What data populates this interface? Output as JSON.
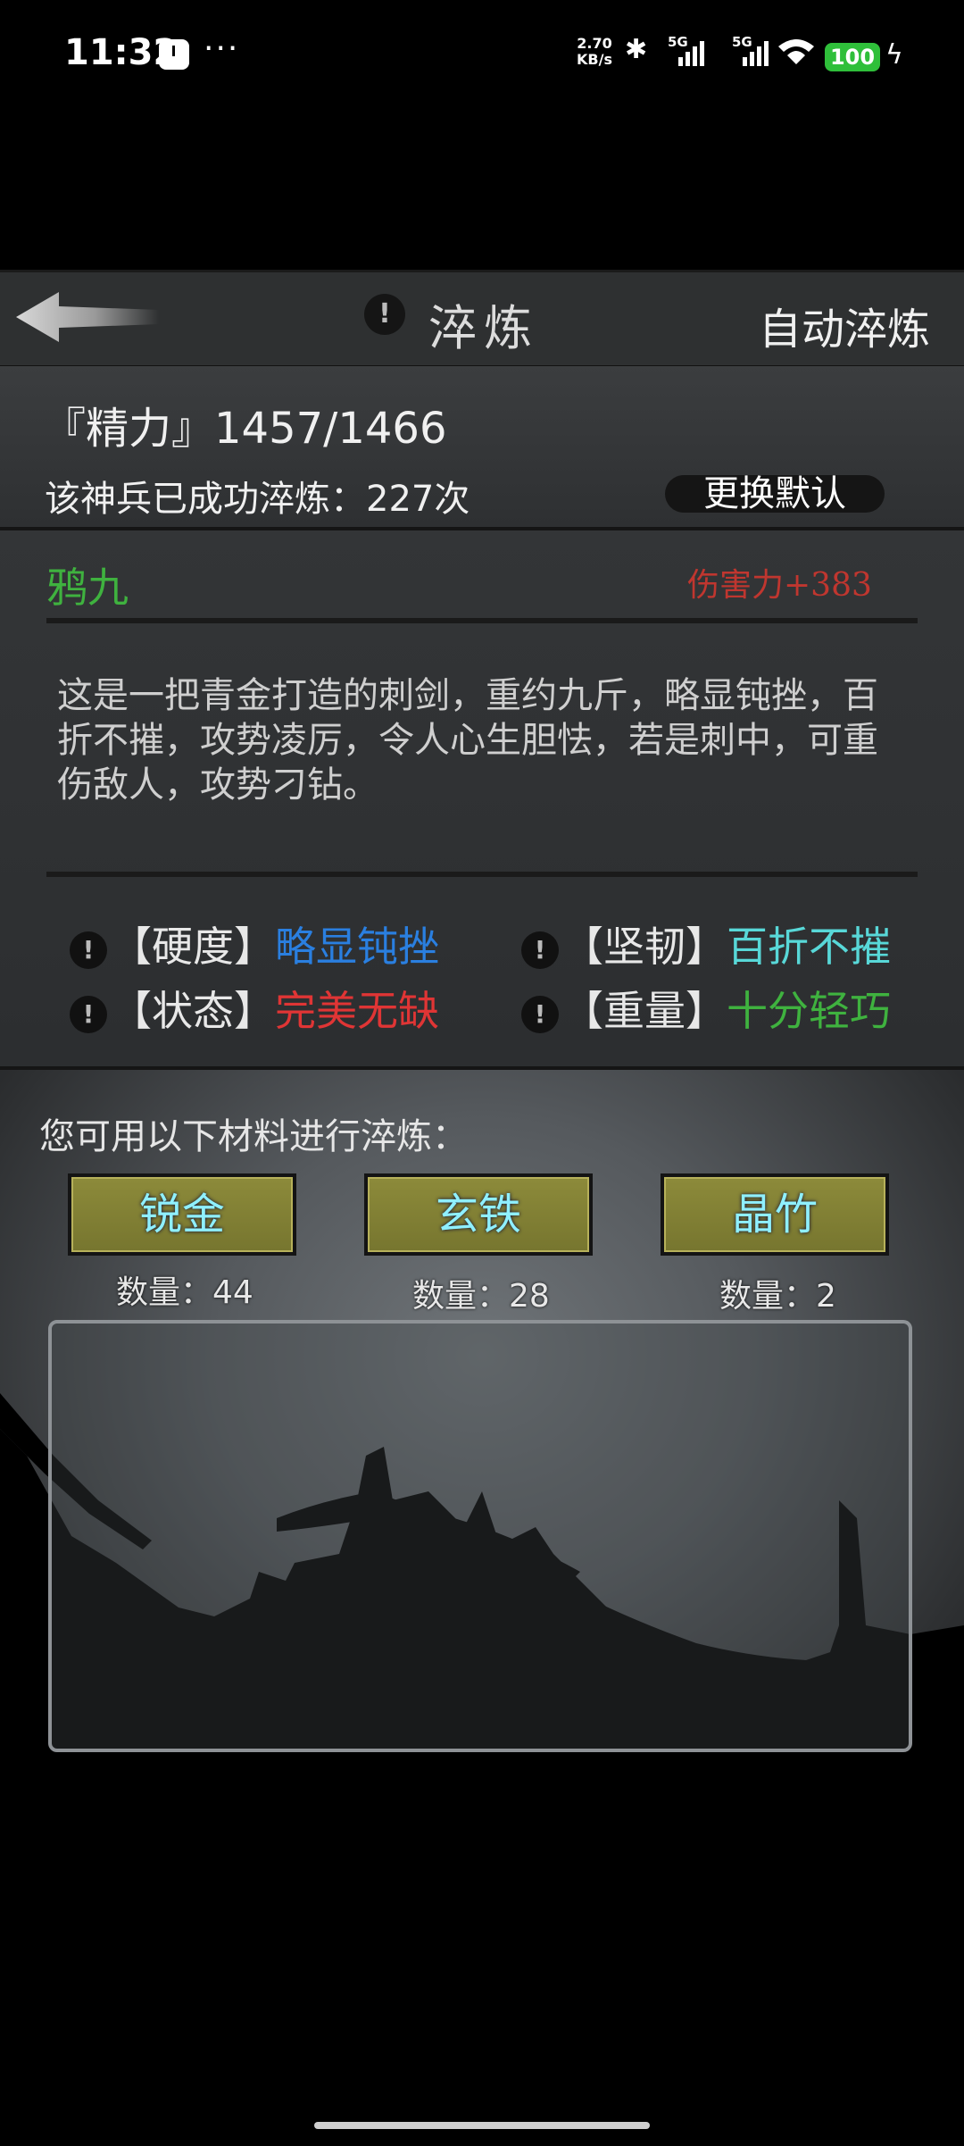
{
  "status_bar": {
    "time": "11:32",
    "dots": "···",
    "net_speed_value": "2.70",
    "net_speed_unit": "KB/s",
    "network_1": "5G",
    "network_2": "5G",
    "battery": "100",
    "icons": [
      "clock-icon",
      "bluetooth-icon",
      "signal-icon",
      "wifi-icon",
      "battery-icon",
      "charging-icon"
    ]
  },
  "header": {
    "title": "淬炼",
    "info_icon": "!",
    "auto_refine_label": "自动淬炼"
  },
  "energy": {
    "line": "『精力』1457/1466",
    "refine_count": "该神兵已成功淬炼：227次",
    "change_default_label": "更换默认"
  },
  "weapon": {
    "name": "鸦九",
    "damage": "伤害力+383",
    "description": "这是一把青金打造的刺剑，重约九斤，略显钝挫，百折不摧，攻势凌厉，令人心生胆怯，若是刺中，可重伤敌人，攻势刁钻。",
    "properties": [
      {
        "key": "【硬度】",
        "value": "略显钝挫",
        "color": "#2a7fe0"
      },
      {
        "key": "【坚韧】",
        "value": "百折不摧",
        "color": "#58d8d8"
      },
      {
        "key": "【状态】",
        "value": "完美无缺",
        "color": "#e03535"
      },
      {
        "key": "【重量】",
        "value": "十分轻巧",
        "color": "#3fb23f"
      }
    ]
  },
  "materials": {
    "prompt": "您可用以下材料进行淬炼：",
    "items": [
      {
        "label": "锐金",
        "qty": "数量：44"
      },
      {
        "label": "玄铁",
        "qty": "数量：28"
      },
      {
        "label": "晶竹",
        "qty": "数量：2"
      }
    ]
  }
}
